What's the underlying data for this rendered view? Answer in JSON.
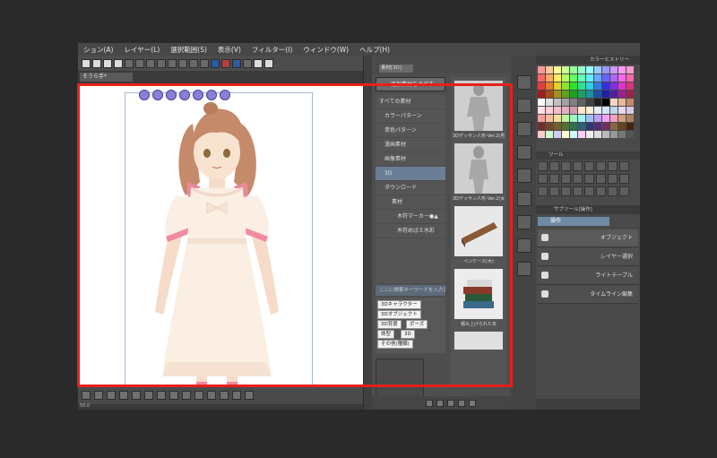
{
  "menu": [
    "ション(A)",
    "レイヤー(L)",
    "選択範囲(S)",
    "表示(V)",
    "フィルター(I)",
    "ウィンドウ(W)",
    "ヘルプ(H)"
  ],
  "canvas": {
    "doc_tab": "そうら手*"
  },
  "material": {
    "panel_tab": "素材[3D]",
    "search_button": "追加素材をさがす",
    "tree": [
      {
        "label": "すべての素材",
        "level": 0,
        "selected": false
      },
      {
        "label": "カラーパターン",
        "level": 1,
        "selected": false
      },
      {
        "label": "単色パターン",
        "level": 1,
        "selected": false
      },
      {
        "label": "漫画素材",
        "level": 1,
        "selected": false
      },
      {
        "label": "画像素材",
        "level": 1,
        "selected": false
      },
      {
        "label": "3D",
        "level": 1,
        "selected": true
      },
      {
        "label": "ダウンロード",
        "level": 1,
        "selected": false
      },
      {
        "label": "素材",
        "level": 2,
        "selected": false
      },
      {
        "label": "木符マーカー●▲",
        "level": 3,
        "selected": false
      },
      {
        "label": "木符めばえ水彩",
        "level": 3,
        "selected": false
      }
    ],
    "tag_search": "ここに検索キーワードを入力して",
    "tags": [
      "3Dキャラクター",
      "3Dオブジェクト",
      "3D背景",
      "ポーズ",
      "体型",
      "3D",
      "その他(種類)",
      "アクション",
      "キャラクター"
    ],
    "thumbnails": [
      {
        "label": "3Dデッサン人形-Ver.2(男性)"
      },
      {
        "label": "3Dデッサン人形-Ver.2(女性)"
      },
      {
        "label": "ペンケース(木)"
      },
      {
        "label": "積み上げられた本"
      }
    ]
  },
  "right": {
    "color_history": "カラーヒストリー",
    "tool_header": "ツール",
    "sub_tool_header": "サブツール[操作]",
    "sub_tool_selected": "操作",
    "sub_tools": [
      "オブジェクト",
      "レイヤー選択",
      "ライトテーブル",
      "タイムライン編集"
    ],
    "palette_colors": [
      "#ff9999",
      "#ffcc99",
      "#ffff99",
      "#ccff99",
      "#99ff99",
      "#99ffcc",
      "#99ffff",
      "#99ccff",
      "#9999ff",
      "#cc99ff",
      "#ff99ff",
      "#ff99cc",
      "#ff6666",
      "#ffaa66",
      "#ffee66",
      "#bbff66",
      "#66ff66",
      "#66ffbb",
      "#66eeff",
      "#66aaff",
      "#6666ff",
      "#aa66ff",
      "#ff66ee",
      "#ff66aa",
      "#e04040",
      "#e08030",
      "#e0d030",
      "#90e030",
      "#30e030",
      "#30e090",
      "#30d0e0",
      "#3080e0",
      "#3030e0",
      "#8030e0",
      "#e030d0",
      "#e03080",
      "#a02020",
      "#a05020",
      "#a09020",
      "#60a020",
      "#20a020",
      "#20a060",
      "#2090a0",
      "#2050a0",
      "#2020a0",
      "#5020a0",
      "#a02090",
      "#a02050",
      "#ffffff",
      "#e0e0e0",
      "#c0c0c0",
      "#a0a0a0",
      "#808080",
      "#606060",
      "#404040",
      "#202020",
      "#000000",
      "#f5d6c0",
      "#e8b89a",
      "#c48a6a",
      "#ffe0e8",
      "#ffd0d8",
      "#f0c0c8",
      "#e0b0c0",
      "#d0a0b0",
      "#ffe6cc",
      "#fff0d6",
      "#e6f0ff",
      "#d6e6ff",
      "#c0d6f0",
      "#e8d8f0",
      "#d8c8e8",
      "#f4a0a0",
      "#f4c0a0",
      "#f4e0a0",
      "#c0f4a0",
      "#a0f4c0",
      "#a0f4f4",
      "#a0c0f4",
      "#c0a0f4",
      "#f4a0f4",
      "#f4a0c0",
      "#d0a080",
      "#b08060",
      "#703030",
      "#704830",
      "#706030",
      "#507030",
      "#307050",
      "#306070",
      "#303870",
      "#503070",
      "#703060",
      "#886644",
      "#664422",
      "#442211",
      "#ffcccc",
      "#ccffcc",
      "#ccccff",
      "#ffffcc",
      "#ccffff",
      "#ffccff",
      "#eeeeee",
      "#dddddd",
      "#bbbbbb",
      "#999999",
      "#777777",
      "#555555"
    ]
  },
  "status": {
    "zoom": "50.0"
  }
}
